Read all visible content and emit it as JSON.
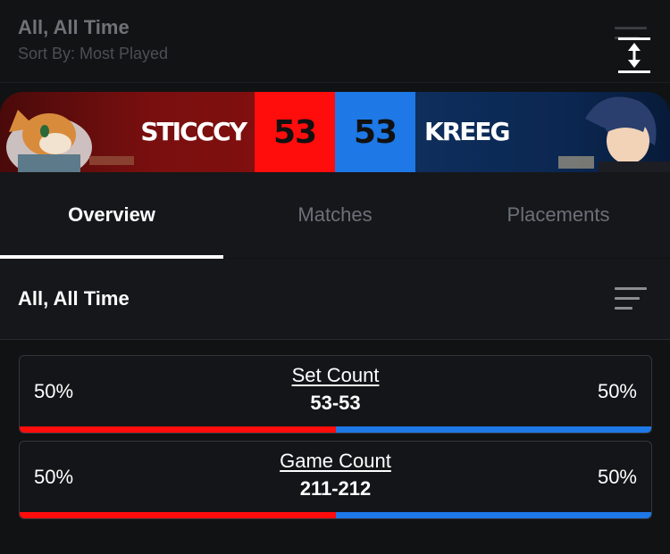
{
  "header": {
    "title": "All, All Time",
    "subtitle": "Sort By: Most Played"
  },
  "versus": {
    "left_player": "STICCCY",
    "left_score": "53",
    "right_player": "KREEG",
    "right_score": "53",
    "colors": {
      "left": "#ff0c0c",
      "right": "#1e78e6"
    }
  },
  "tabs": [
    {
      "label": "Overview",
      "active": true
    },
    {
      "label": "Matches",
      "active": false
    },
    {
      "label": "Placements",
      "active": false
    }
  ],
  "section": {
    "title": "All, All Time"
  },
  "stats": [
    {
      "label": "Set Count",
      "value": "53-53",
      "left_pct": "50%",
      "right_pct": "50%",
      "left_share": 0.5
    },
    {
      "label": "Game Count",
      "value": "211-212",
      "left_pct": "50%",
      "right_pct": "50%",
      "left_share": 0.5
    }
  ]
}
